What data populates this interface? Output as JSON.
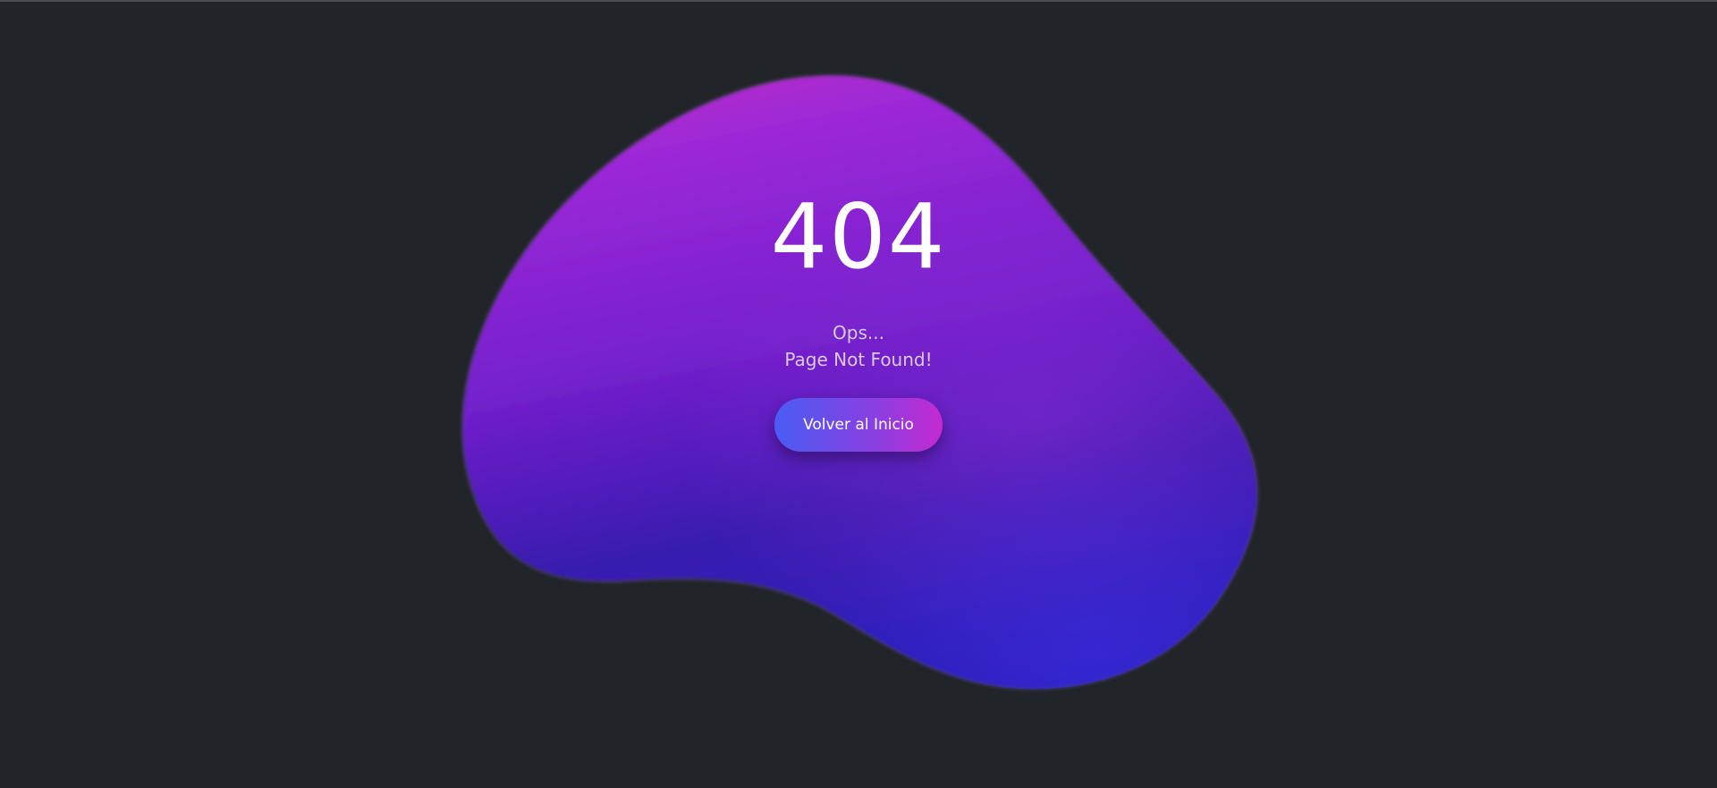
{
  "error": {
    "code": "404",
    "message_line1": "Ops...",
    "message_line2": "Page Not Found!"
  },
  "actions": {
    "home_button_label": "Volver al Inicio"
  },
  "colors": {
    "background": "#212428",
    "blob_top": "#b733c4",
    "blob_mid": "#7e22ce",
    "blob_bottom": "#2e1fb0",
    "button_start": "#4a5cf4",
    "button_end": "#c42ad0"
  }
}
